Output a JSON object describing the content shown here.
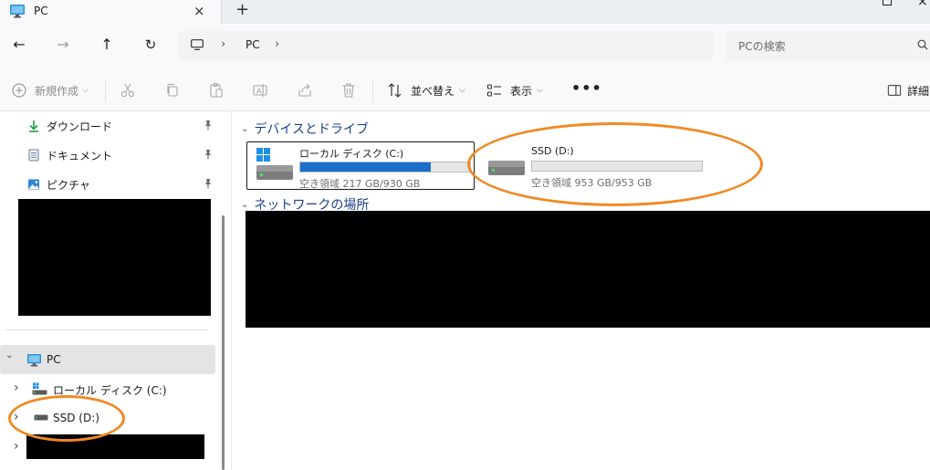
{
  "window": {
    "tab_title": "PC",
    "tab_close": "×",
    "new_tab": "+",
    "close_glyph": "×"
  },
  "address_bar": {
    "back_glyph": "←",
    "forward_glyph": "→",
    "up_glyph": "↑",
    "refresh_glyph": "↻",
    "separator": "›",
    "crumb": "PC",
    "search_placeholder": "PCの検索"
  },
  "command_bar": {
    "new_label": "新規作成",
    "sort_label": "並べ替え",
    "view_label": "表示",
    "more_label": "•••",
    "details_label": "詳細",
    "chevron": "⌵"
  },
  "sidebar": {
    "quick_access": [
      {
        "label": "ダウンロード",
        "icon": "download-icon"
      },
      {
        "label": "ドキュメント",
        "icon": "document-icon"
      },
      {
        "label": "ピクチャ",
        "icon": "picture-icon"
      }
    ],
    "tree": {
      "chevron_expanded": "⌄",
      "chevron_collapsed": "›",
      "pc_label": "PC",
      "items": [
        {
          "label": "ローカル ディスク (C:)"
        },
        {
          "label": "SSD (D:)"
        }
      ]
    }
  },
  "content": {
    "group_chevron": "⌄",
    "devices_heading": "デバイスとドライブ",
    "network_heading": "ネットワークの場所",
    "drives": [
      {
        "name": "ローカル ディスク (C:)",
        "free_text": "空き領域 217 GB/930 GB",
        "used_fraction": 0.767,
        "selected": true
      },
      {
        "name": "SSD (D:)",
        "free_text": "空き領域 953 GB/953 GB",
        "used_fraction": 0.0,
        "selected": false
      }
    ]
  },
  "colors": {
    "accent": "#1a6fc9",
    "group_heading": "#1b3f8b",
    "annotation": "#f08a24",
    "selection_bg": "#e4e4e4"
  }
}
